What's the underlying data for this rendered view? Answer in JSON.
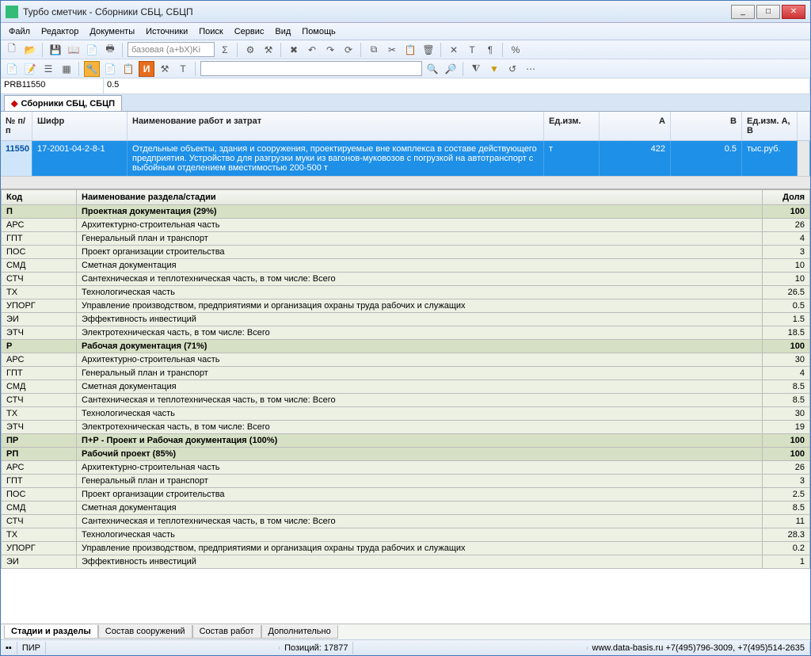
{
  "window": {
    "title": "Турбо сметчик - Сборники СБЦ, СБЦП"
  },
  "menu": [
    "Файл",
    "Редактор",
    "Документы",
    "Источники",
    "Поиск",
    "Сервис",
    "Вид",
    "Помощь"
  ],
  "combo1": "базовая (a+bX)Ki",
  "field_left": "PRB11550",
  "field_right": "0.5",
  "tab_main": "Сборники СБЦ, СБЦП",
  "grid1": {
    "headers": {
      "num": "№ п/п",
      "code": "Шифр",
      "name": "Наименование работ и затрат",
      "unit": "Ед.изм.",
      "a": "А",
      "b": "В",
      "unitab": "Ед.изм. А, В"
    },
    "row": {
      "num": "11550",
      "code": "17-2001-04-2-8-1",
      "name": "Отдельные объекты, здания и сооружения, проектируемые вне комплекса в составе действующего предприятия. Устройство для разгрузки муки из вагонов-муковозов с погрузкой на автотранспорт с выбойным отделением вместимостью 200-500 т",
      "unit": "т",
      "a": "422",
      "b": "0.5",
      "unitab": "тыс.руб."
    }
  },
  "grid2": {
    "headers": {
      "code": "Код",
      "name": "Наименование раздела/стадии",
      "share": "Доля"
    },
    "rows": [
      {
        "code": "П",
        "name": "Проектная документация (29%)",
        "share": "100",
        "bold": true
      },
      {
        "code": "АРС",
        "name": "Архитектурно-строительная часть",
        "share": "26"
      },
      {
        "code": "ГПТ",
        "name": "Генеральный план и транспорт",
        "share": "4"
      },
      {
        "code": "ПОС",
        "name": "Проект организации строительства",
        "share": "3"
      },
      {
        "code": "СМД",
        "name": "Сметная документация",
        "share": "10"
      },
      {
        "code": "СТЧ",
        "name": "Сантехническая и теплотехническая часть, в том числе: Всего",
        "share": "10"
      },
      {
        "code": "ТХ",
        "name": "Технологическая часть",
        "share": "26.5"
      },
      {
        "code": "УПОРГ",
        "name": "Управление производством, предприятиями и организация охраны труда рабочих и служащих",
        "share": "0.5"
      },
      {
        "code": "ЭИ",
        "name": "Эффективность инвестиций",
        "share": "1.5"
      },
      {
        "code": "ЭТЧ",
        "name": "Электротехническая часть, в том числе: Всего",
        "share": "18.5"
      },
      {
        "code": "Р",
        "name": "Рабочая документация (71%)",
        "share": "100",
        "bold": true
      },
      {
        "code": "АРС",
        "name": "Архитектурно-строительная часть",
        "share": "30"
      },
      {
        "code": "ГПТ",
        "name": "Генеральный план и транспорт",
        "share": "4"
      },
      {
        "code": "СМД",
        "name": "Сметная документация",
        "share": "8.5"
      },
      {
        "code": "СТЧ",
        "name": "Сантехническая и теплотехническая часть, в том числе: Всего",
        "share": "8.5"
      },
      {
        "code": "ТХ",
        "name": "Технологическая часть",
        "share": "30"
      },
      {
        "code": "ЭТЧ",
        "name": "Электротехническая часть, в том числе: Всего",
        "share": "19"
      },
      {
        "code": "ПР",
        "name": "П+Р - Проект и Рабочая документация (100%)",
        "share": "100",
        "bold": true
      },
      {
        "code": "РП",
        "name": "Рабочий проект (85%)",
        "share": "100",
        "bold": true
      },
      {
        "code": "АРС",
        "name": "Архитектурно-строительная часть",
        "share": "26"
      },
      {
        "code": "ГПТ",
        "name": "Генеральный план и транспорт",
        "share": "3"
      },
      {
        "code": "ПОС",
        "name": "Проект организации строительства",
        "share": "2.5"
      },
      {
        "code": "СМД",
        "name": "Сметная документация",
        "share": "8.5"
      },
      {
        "code": "СТЧ",
        "name": "Сантехническая и теплотехническая часть, в том числе: Всего",
        "share": "11"
      },
      {
        "code": "ТХ",
        "name": "Технологическая часть",
        "share": "28.3"
      },
      {
        "code": "УПОРГ",
        "name": "Управление производством, предприятиями и организация охраны труда рабочих и служащих",
        "share": "0.2"
      },
      {
        "code": "ЭИ",
        "name": "Эффективность инвестиций",
        "share": "1"
      }
    ]
  },
  "bottom_tabs": [
    "Стадии и разделы",
    "Состав сооружений",
    "Состав работ",
    "Дополнительно"
  ],
  "status": {
    "s1": "ПИР",
    "s2": "Позиций: 17877",
    "s3": "www.data-basis.ru  +7(495)796-3009, +7(495)514-2635"
  }
}
